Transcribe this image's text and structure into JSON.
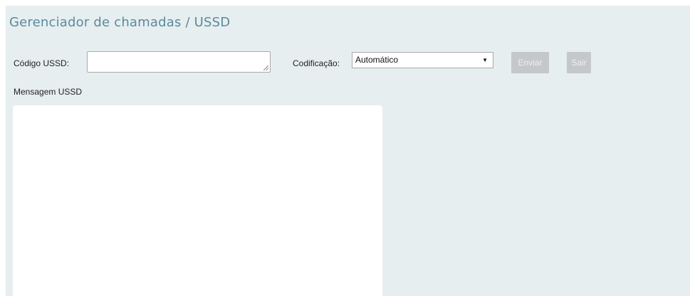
{
  "header": {
    "title": "Gerenciador de chamadas / USSD"
  },
  "form": {
    "ussd_code_label": "Código USSD:",
    "ussd_code_value": "",
    "encoding_label": "Codificação:",
    "encoding_selected": "Automático",
    "send_label": "Enviar",
    "exit_label": "Sair"
  },
  "message": {
    "label": "Mensagem USSD",
    "content": ""
  },
  "colors": {
    "panel_background": "#e6eef0",
    "title": "#5b8a9c",
    "disabled_button": "#c4c8ca"
  },
  "icons": {
    "select_arrow": "caret-down-icon",
    "textarea_grip": "resize-grip-icon"
  }
}
